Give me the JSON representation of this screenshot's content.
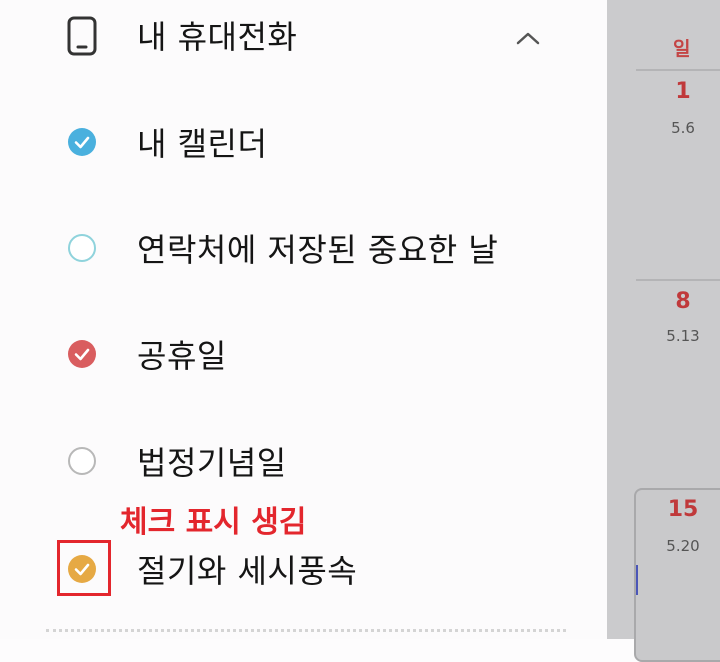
{
  "section": {
    "title": "내 휴대전화",
    "icon": "phone-icon",
    "collapse_icon": "chevron-up-icon"
  },
  "calendars": [
    {
      "label": "내 캘린더",
      "checked": true,
      "color": "#4ab0de"
    },
    {
      "label": "연락처에 저장된 중요한 날",
      "checked": false,
      "color": "#8fd3dc"
    },
    {
      "label": "공휴일",
      "checked": true,
      "color": "#d95d5f"
    },
    {
      "label": "법정기념일",
      "checked": false,
      "color": "#b8b8b8"
    },
    {
      "label": "절기와 세시풍속",
      "checked": true,
      "color": "#e6a944"
    }
  ],
  "annotation": {
    "text": "체크 표시 생김",
    "color": "#e3262d"
  },
  "calendar_view": {
    "day_header": "일",
    "dates": [
      {
        "day": "1",
        "lunar": "5.6"
      },
      {
        "day": "8",
        "lunar": "5.13"
      },
      {
        "day": "15",
        "lunar": "5.20"
      }
    ]
  }
}
